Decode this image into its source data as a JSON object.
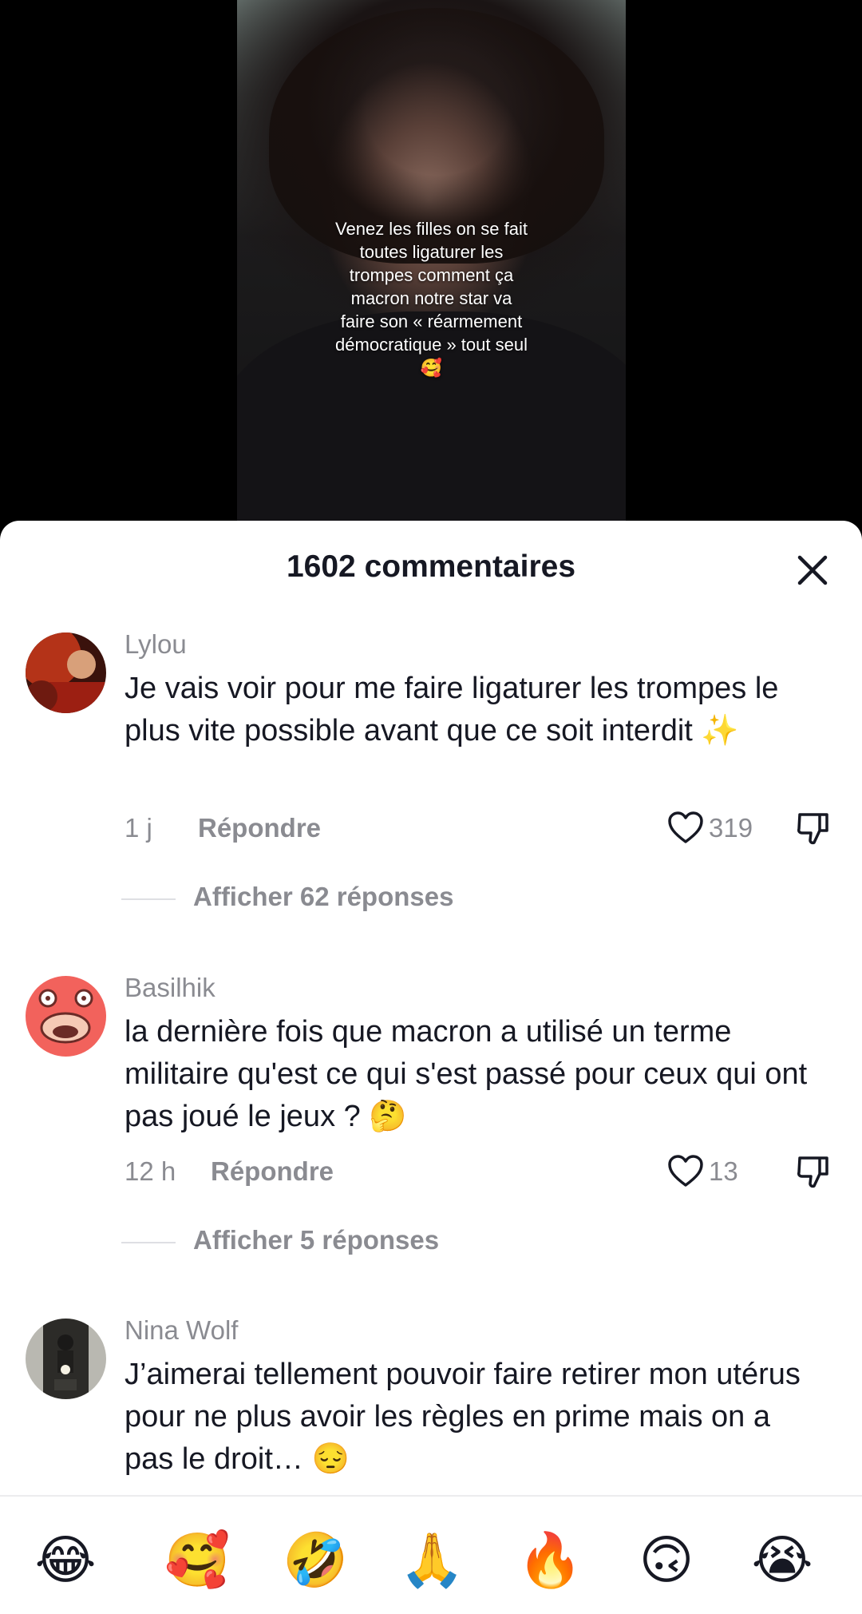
{
  "video": {
    "caption": "Venez les filles on se fait\ntoutes ligaturer les\ntrompes comment ça\nmacron notre star va\nfaire son « réarmement\ndémocratique » tout seul\n🥰"
  },
  "comments_panel": {
    "title": "1602 commentaires",
    "close_icon": "close-icon"
  },
  "comments": [
    {
      "username": "Lylou",
      "text": "Je vais voir pour me faire ligaturer les trompes le plus vite possible avant que ce soit interdit ✨",
      "time": "1 j",
      "reply_label": "Répondre",
      "likes": "319",
      "replies_label": "Afficher 62 réponses"
    },
    {
      "username": "Basilhik",
      "text": "la dernière fois que macron a utilisé un terme militaire qu'est ce qui s'est passé pour ceux qui ont pas joué le jeux ? 🤔",
      "time": "12 h",
      "reply_label": "Répondre",
      "likes": "13",
      "replies_label": "Afficher 5 réponses"
    },
    {
      "username": "Nina Wolf",
      "text": "J’aimerai tellement pouvoir faire retirer mon utérus pour ne plus avoir les règles en prime mais on a pas le droit… 😔"
    }
  ],
  "emoji_bar": [
    "😂",
    "🥰",
    "🤣",
    "🙏",
    "🔥",
    "🙃",
    "😭"
  ],
  "colors": {
    "text_primary": "#161823",
    "text_secondary": "#8a8b91",
    "sheet_bg": "#ffffff",
    "video_bg": "#000000"
  }
}
